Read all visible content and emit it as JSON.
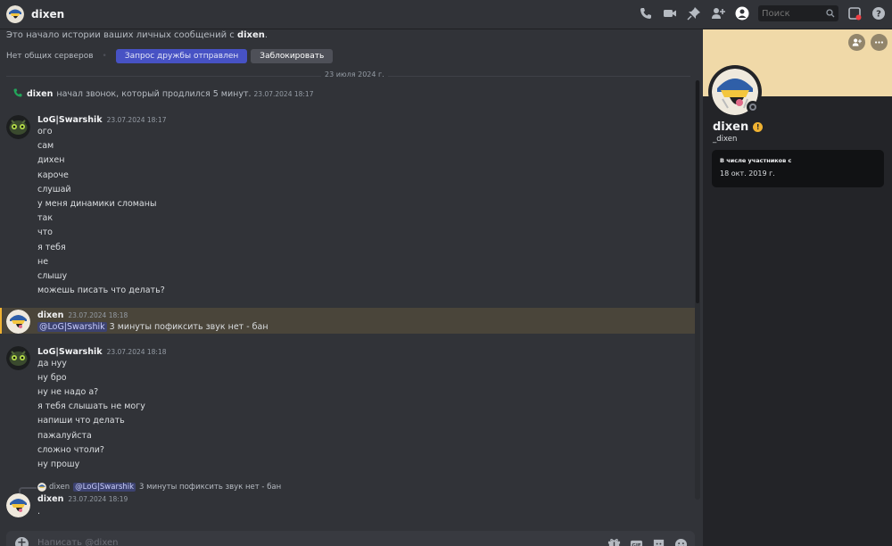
{
  "header": {
    "title": "dixen",
    "search_placeholder": "Поиск"
  },
  "intro": {
    "text": "Это начало истории ваших личных сообщений с",
    "name": "dixen",
    "end": ".",
    "no_servers": "Нет общих серверов",
    "friend_request": "Запрос дружбы отправлен",
    "block": "Заблокировать"
  },
  "divider_date": "23 июля 2024 г.",
  "call": {
    "name": "dixen",
    "text": "начал звонок, который продлился 5 минут.",
    "time": "23.07.2024 18:17"
  },
  "messages": [
    {
      "author": "LoG|Swarshik",
      "time": "23.07.2024 18:17",
      "lines": [
        "ого",
        "сам",
        "дихен",
        "кароче",
        "слушай",
        "у меня динамики сломаны",
        "так",
        "что",
        "я тебя",
        "не",
        "слышу",
        "можешь писать что делать?"
      ]
    },
    {
      "author": "dixen",
      "time": "23.07.2024 18:18",
      "mention": "@LoG|Swarshik",
      "text": "3 минуты пофиксить звук нет - бан"
    },
    {
      "author": "LoG|Swarshik",
      "time": "23.07.2024 18:18",
      "lines": [
        "да нуу",
        "ну бро",
        "ну не надо а?",
        "я тебя слышать не могу",
        "напиши что делать",
        "пажалуйста",
        "сложно чтоли?",
        "ну прошу"
      ]
    },
    {
      "reply": {
        "name": "dixen",
        "mention": "@LoG|Swarshik",
        "text": "3 минуты пофиксить звук нет - бан"
      },
      "author": "dixen",
      "time": "23.07.2024 18:19",
      "text": "."
    }
  ],
  "composer": {
    "placeholder": "Написать @dixen"
  },
  "profile": {
    "name": "dixen",
    "handle": "_dixen",
    "member_since_label": "В числе участников с",
    "member_since": "18 окт. 2019 г.",
    "banner_color": "#f0d9a8"
  },
  "colors": {
    "accent": "#4752c4",
    "highlight": "#4a453a",
    "highlight_bar": "#f0b232",
    "call_icon": "#23a55a"
  },
  "icons": [
    "phone-icon",
    "video-icon",
    "pin-icon",
    "add-friend-icon",
    "profile-toggle-icon",
    "search-icon",
    "inbox-icon",
    "help-icon",
    "plus-icon",
    "gift-icon",
    "gif-icon",
    "sticker-icon",
    "emoji-icon",
    "more-icon"
  ]
}
